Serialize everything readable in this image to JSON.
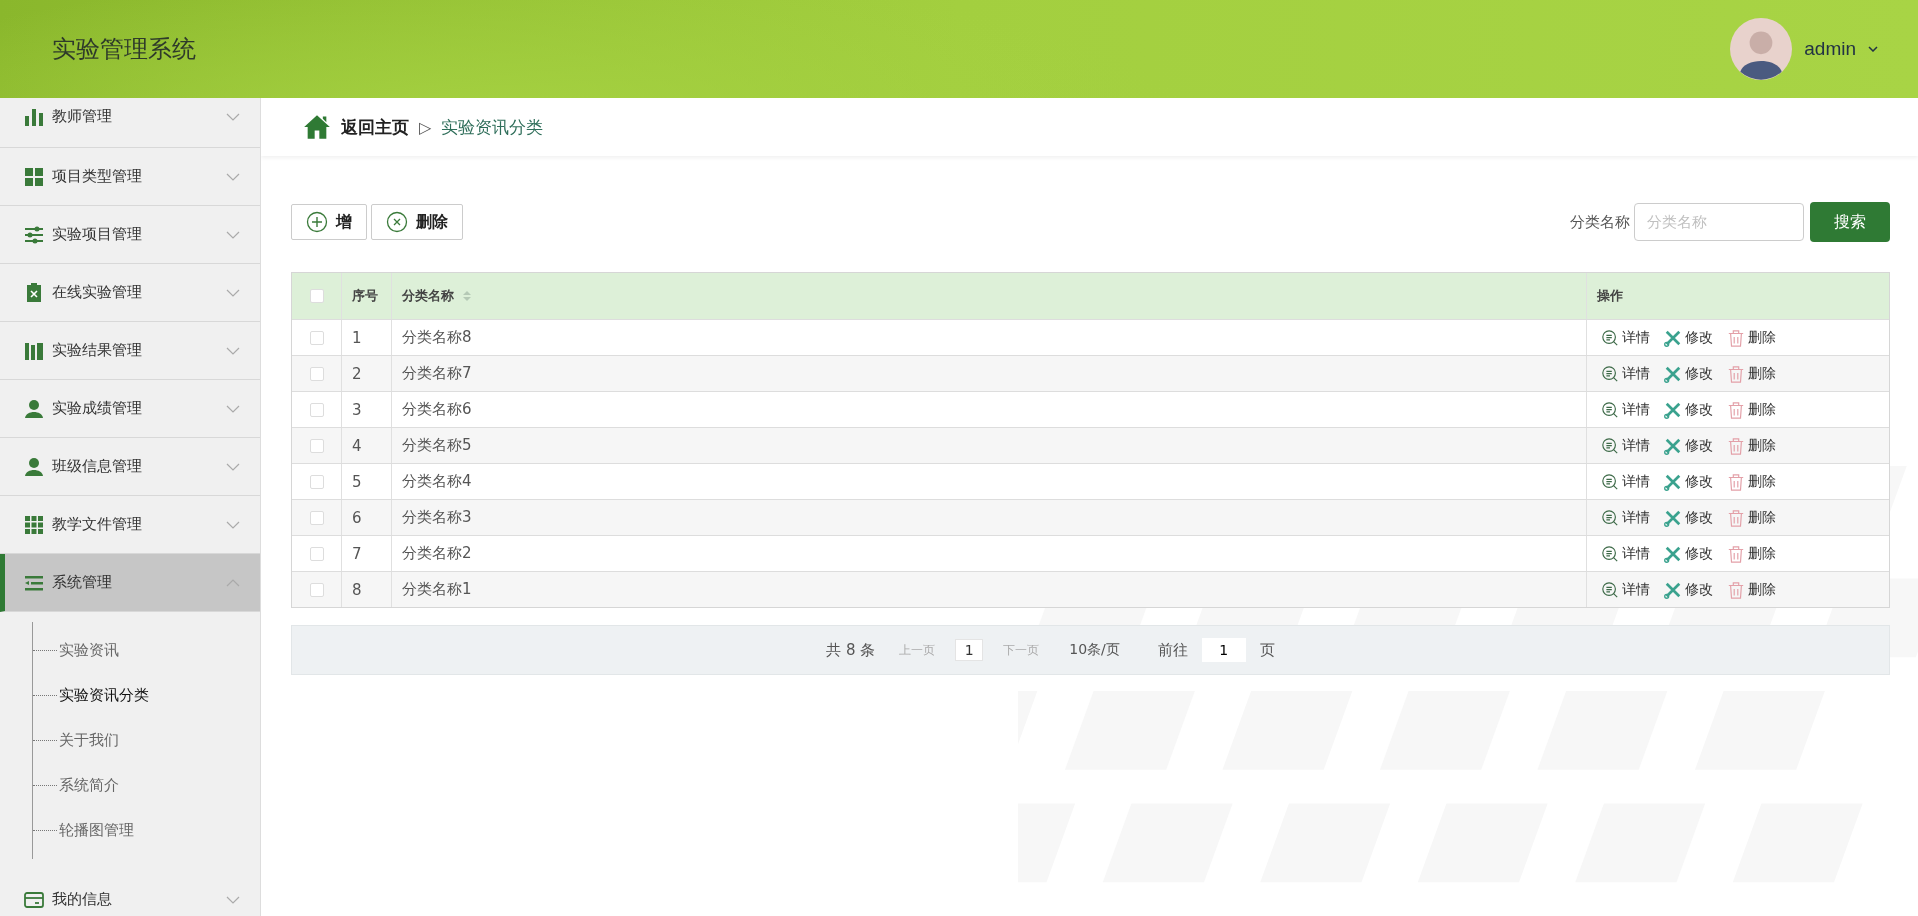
{
  "header": {
    "title": "实验管理系统",
    "user": "admin"
  },
  "sidebar": {
    "items": [
      {
        "label": "教师管理",
        "expanded": false
      },
      {
        "label": "项目类型管理",
        "expanded": false
      },
      {
        "label": "实验项目管理",
        "expanded": false
      },
      {
        "label": "在线实验管理",
        "expanded": false
      },
      {
        "label": "实验结果管理",
        "expanded": false
      },
      {
        "label": "实验成绩管理",
        "expanded": false
      },
      {
        "label": "班级信息管理",
        "expanded": false
      },
      {
        "label": "教学文件管理",
        "expanded": false
      },
      {
        "label": "系统管理",
        "expanded": true,
        "children": [
          {
            "label": "实验资讯",
            "selected": false
          },
          {
            "label": "实验资讯分类",
            "selected": true
          },
          {
            "label": "关于我们",
            "selected": false
          },
          {
            "label": "系统简介",
            "selected": false
          },
          {
            "label": "轮播图管理",
            "selected": false
          }
        ]
      },
      {
        "label": "我的信息",
        "expanded": false
      }
    ]
  },
  "breadcrumb": {
    "home": "返回主页",
    "separator": "▷",
    "current": "实验资讯分类"
  },
  "toolbar": {
    "buttons": [
      {
        "kind": "add",
        "label": "增"
      },
      {
        "kind": "delete",
        "label": "删除"
      }
    ],
    "search": {
      "label": "分类名称",
      "placeholder": "分类名称",
      "button": "搜索"
    }
  },
  "table": {
    "select_all_checked": false,
    "columns": [
      "序号",
      "分类名称",
      "操作"
    ],
    "rows": [
      {
        "checked": false,
        "index": "1",
        "name": "分类名称8",
        "actions": [
          {
            "kind": "detail",
            "label": "详情"
          },
          {
            "kind": "edit",
            "label": "修改"
          },
          {
            "kind": "delete",
            "label": "删除"
          }
        ]
      },
      {
        "checked": false,
        "index": "2",
        "name": "分类名称7",
        "actions": [
          {
            "kind": "detail",
            "label": "详情"
          },
          {
            "kind": "edit",
            "label": "修改"
          },
          {
            "kind": "delete",
            "label": "删除"
          }
        ]
      },
      {
        "checked": false,
        "index": "3",
        "name": "分类名称6",
        "actions": [
          {
            "kind": "detail",
            "label": "详情"
          },
          {
            "kind": "edit",
            "label": "修改"
          },
          {
            "kind": "delete",
            "label": "删除"
          }
        ]
      },
      {
        "checked": false,
        "index": "4",
        "name": "分类名称5",
        "actions": [
          {
            "kind": "detail",
            "label": "详情"
          },
          {
            "kind": "edit",
            "label": "修改"
          },
          {
            "kind": "delete",
            "label": "删除"
          }
        ]
      },
      {
        "checked": false,
        "index": "5",
        "name": "分类名称4",
        "actions": [
          {
            "kind": "detail",
            "label": "详情"
          },
          {
            "kind": "edit",
            "label": "修改"
          },
          {
            "kind": "delete",
            "label": "删除"
          }
        ]
      },
      {
        "checked": false,
        "index": "6",
        "name": "分类名称3",
        "actions": [
          {
            "kind": "detail",
            "label": "详情"
          },
          {
            "kind": "edit",
            "label": "修改"
          },
          {
            "kind": "delete",
            "label": "删除"
          }
        ]
      },
      {
        "checked": false,
        "index": "7",
        "name": "分类名称2",
        "actions": [
          {
            "kind": "detail",
            "label": "详情"
          },
          {
            "kind": "edit",
            "label": "修改"
          },
          {
            "kind": "delete",
            "label": "删除"
          }
        ]
      },
      {
        "checked": false,
        "index": "8",
        "name": "分类名称1",
        "actions": [
          {
            "kind": "detail",
            "label": "详情"
          },
          {
            "kind": "edit",
            "label": "修改"
          },
          {
            "kind": "delete",
            "label": "删除"
          }
        ]
      }
    ]
  },
  "pagination": {
    "total": "共 8 条",
    "prev": {
      "label": "上一页",
      "disabled": true
    },
    "page": "1",
    "next": {
      "label": "下一页",
      "disabled": true
    },
    "page_size": "10条/页",
    "goto": "前往",
    "goto_value": "1",
    "goto_suffix": "页"
  }
}
